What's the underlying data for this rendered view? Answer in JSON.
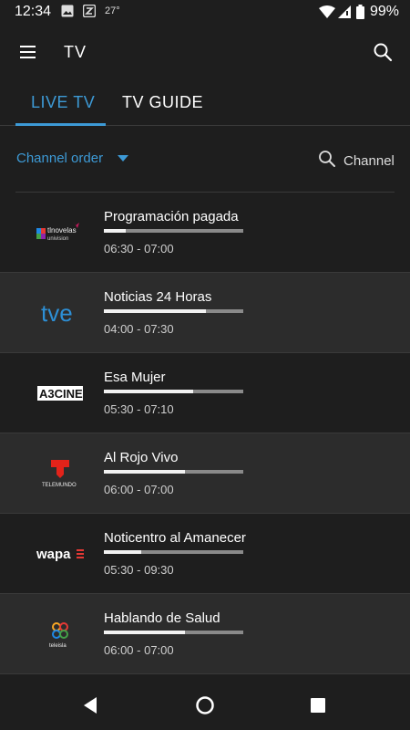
{
  "status_bar": {
    "time": "12:34",
    "temperature": "27°",
    "battery": "99%"
  },
  "app_bar": {
    "title": "TV"
  },
  "tabs": [
    {
      "label": "LIVE TV",
      "active": true
    },
    {
      "label": "TV GUIDE",
      "active": false
    }
  ],
  "filter": {
    "order_label": "Channel order",
    "channel_search_label": "Channel"
  },
  "accent_color": "#3d9ad6",
  "programs": [
    {
      "channel_logo": "tlnovelas-univision-logo",
      "logo_text_1": "tlnovelas",
      "logo_text_2": "univision",
      "title": "Programación pagada",
      "time": "06:30 - 07:00",
      "progress": 0.16
    },
    {
      "channel_logo": "tve-logo",
      "logo_text_1": "tve",
      "title": "Noticias 24 Horas",
      "time": "04:00 - 07:30",
      "progress": 0.73
    },
    {
      "channel_logo": "a3cine-logo",
      "logo_text_1": "A3CINE",
      "title": "Esa Mujer",
      "time": "05:30 - 07:10",
      "progress": 0.64
    },
    {
      "channel_logo": "telemundo-logo",
      "logo_text_1": "TELEMUNDO",
      "title": "Al Rojo Vivo",
      "time": "06:00 - 07:00",
      "progress": 0.58
    },
    {
      "channel_logo": "wapa-logo",
      "logo_text_1": "wapa",
      "title": "Noticentro al Amanecer",
      "time": "05:30 - 09:30",
      "progress": 0.27
    },
    {
      "channel_logo": "teleisla-logo",
      "logo_text_1": "teleisla",
      "title": "Hablando de Salud",
      "time": "06:00 - 07:00",
      "progress": 0.58
    }
  ]
}
